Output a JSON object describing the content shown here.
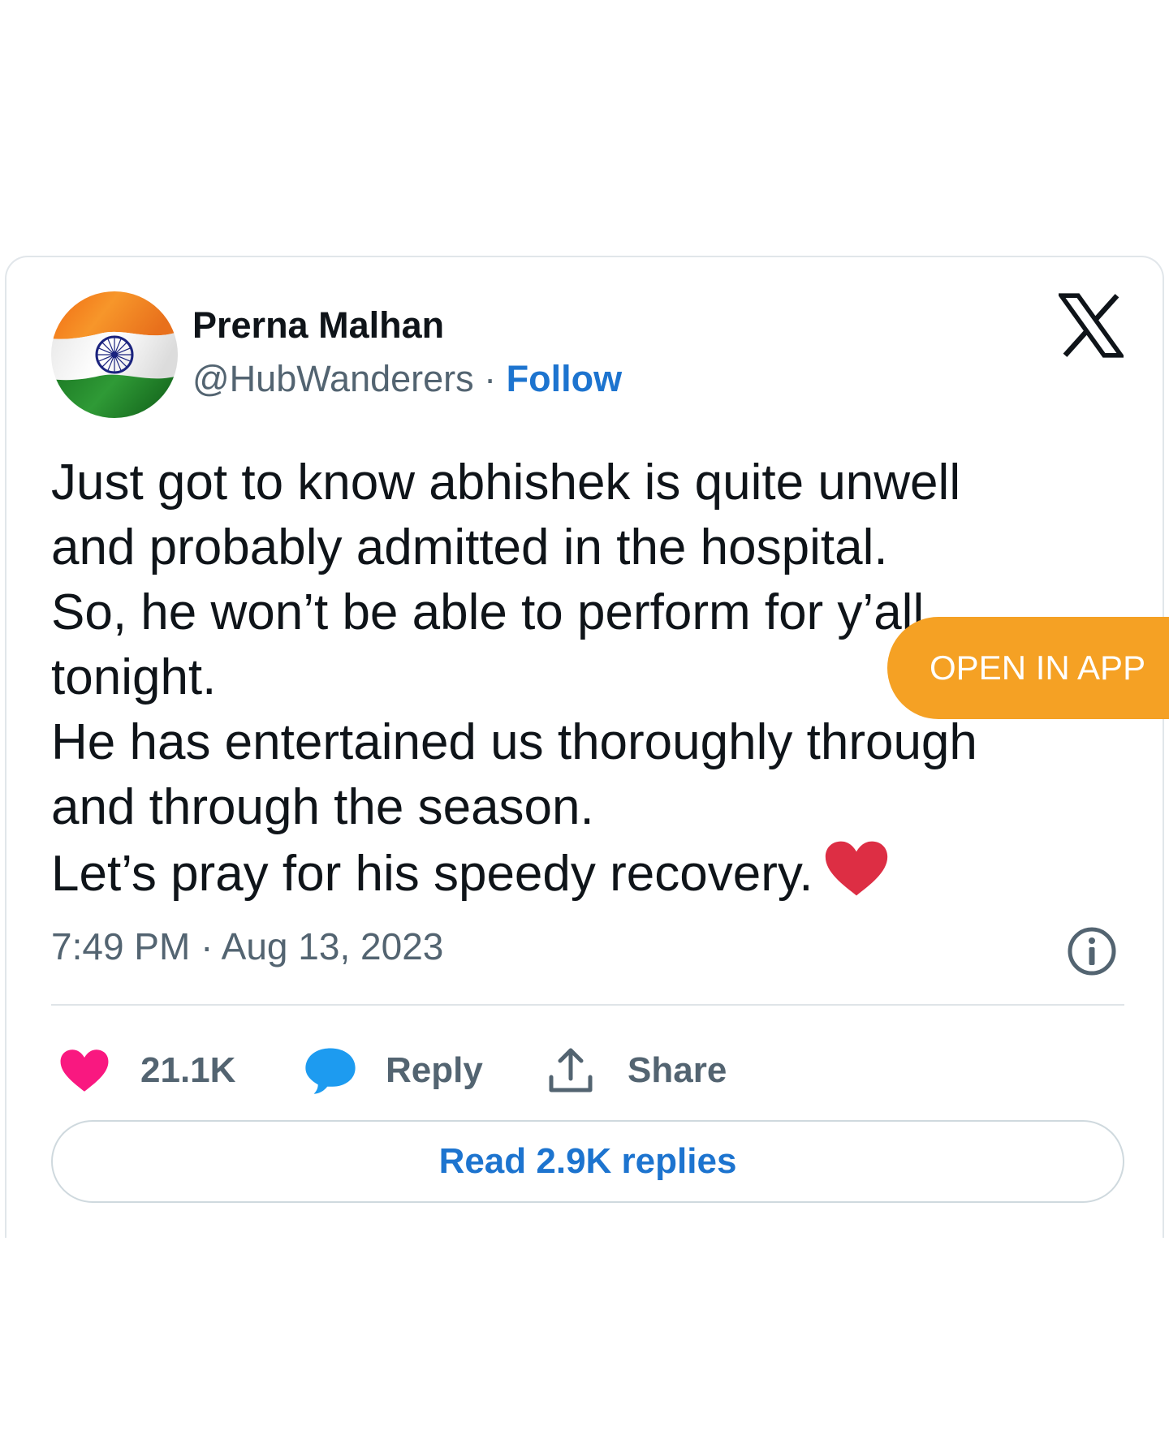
{
  "author": {
    "name": "Prerna Malhan",
    "handle": "@HubWanderers",
    "separator": "·",
    "follow_label": "Follow",
    "avatar_icon": "india-flag-avatar"
  },
  "brand": {
    "logo_icon": "x-logo-icon"
  },
  "tweet": {
    "lines": [
      "Just got to know abhishek is quite unwell",
      "and probably admitted in the hospital.",
      "So, he won’t be able to perform for y’all",
      "tonight.",
      "He has entertained us thoroughly through",
      "and through the season.",
      "Let’s pray for his speedy recovery."
    ],
    "emoji_icon": "red-heart-emoji",
    "time": "7:49 PM",
    "date_separator": "·",
    "date": "Aug 13, 2023"
  },
  "banner": {
    "open_in_app_label": "OPEN IN APP"
  },
  "actions": {
    "like_count": "21.1K",
    "reply_label": "Reply",
    "share_label": "Share"
  },
  "read_replies_label": "Read 2.9K replies",
  "colors": {
    "link_blue": "#1d74cf",
    "like_pink": "#f91880",
    "reply_blue": "#1d9bf0",
    "open_app_orange": "#f5a124",
    "muted_text": "#536471"
  }
}
